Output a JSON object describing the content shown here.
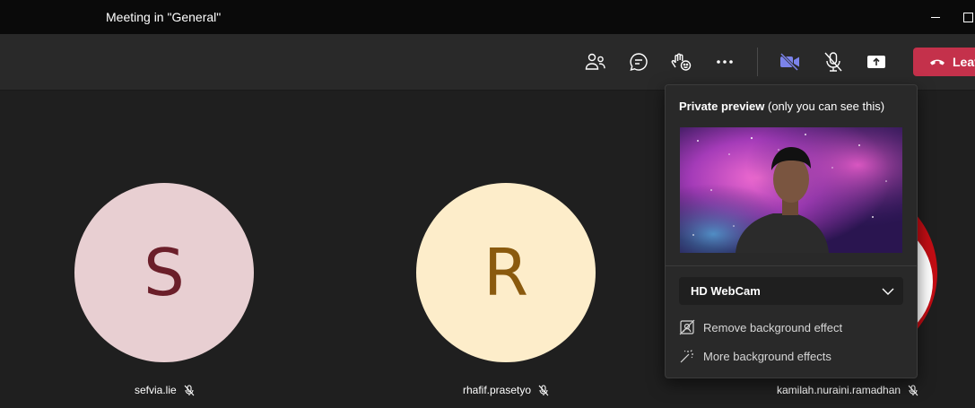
{
  "window": {
    "title": "Meeting in \"General\""
  },
  "toolbar": {
    "icons": [
      "people-icon",
      "chat-icon",
      "reactions-icon",
      "more-icon",
      "camera-off-icon",
      "mic-off-icon",
      "share-icon"
    ],
    "leave_label": "Leave",
    "leave_color": "#c4314b",
    "camera_color": "#7b83eb"
  },
  "participants": [
    {
      "initial": "S",
      "name": "sefvia.lie",
      "muted": true
    },
    {
      "initial": "R",
      "name": "rhafif.prasetyo",
      "muted": true
    },
    {
      "initial": "",
      "name": "kamilah.nuraini.ramadhan",
      "muted": true
    }
  ],
  "preview": {
    "title_bold": "Private preview",
    "title_rest": " (only you can see this)",
    "camera_selected": "HD WebCam",
    "effects": [
      {
        "label": "Remove background effect",
        "icon": "no-background-icon"
      },
      {
        "label": "More background effects",
        "icon": "magic-wand-icon"
      }
    ]
  }
}
